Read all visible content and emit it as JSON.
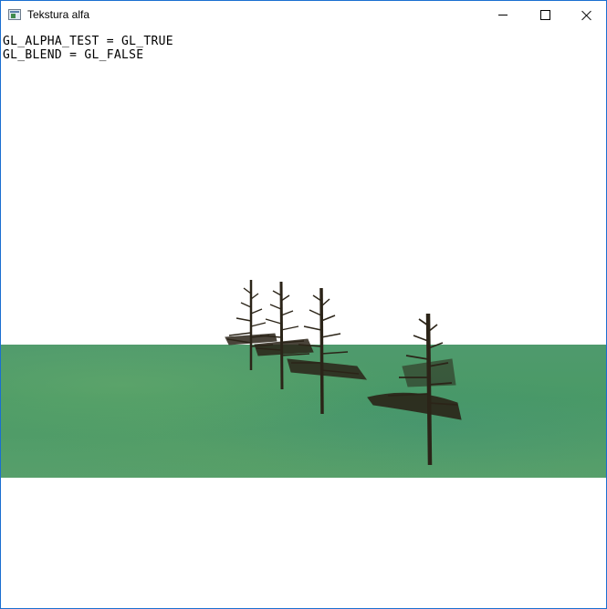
{
  "window": {
    "title": "Tekstura alfa",
    "controls": {
      "minimize": "minimize",
      "maximize": "maximize",
      "close": "close"
    }
  },
  "hud": {
    "alpha_test": "GL_ALPHA_TEST = GL_TRUE",
    "blend": "GL_BLEND = GL_FALSE"
  },
  "scene": {
    "ground_color": "#4f9a6d",
    "trunk_color": "#2b2418",
    "tree_count": 4
  }
}
